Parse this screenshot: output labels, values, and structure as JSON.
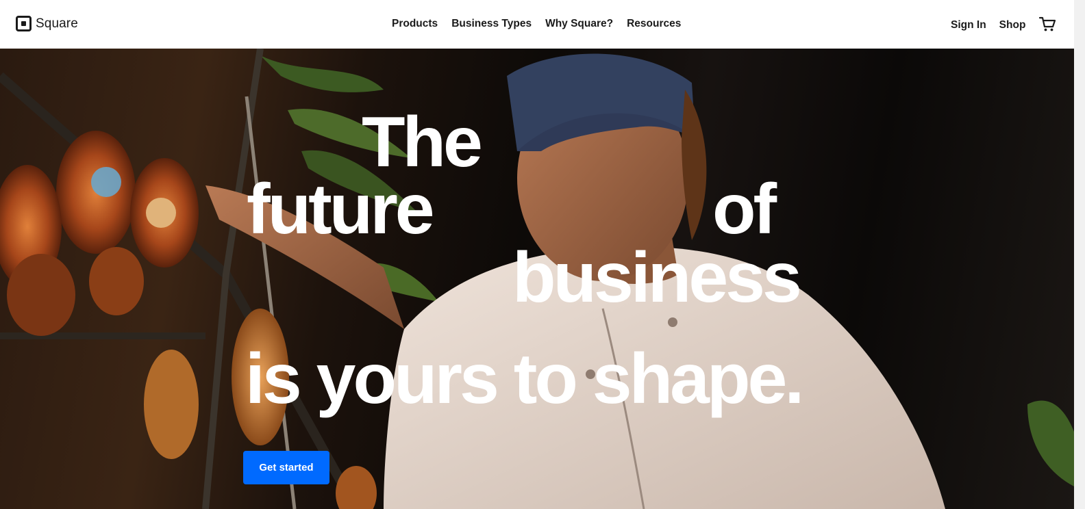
{
  "header": {
    "logo_text": "Square",
    "nav": [
      {
        "label": "Products"
      },
      {
        "label": "Business Types"
      },
      {
        "label": "Why Square?"
      },
      {
        "label": "Resources"
      }
    ],
    "sign_in_label": "Sign In",
    "shop_label": "Shop",
    "cart_icon": "shopping-cart-icon"
  },
  "hero": {
    "headline": {
      "line1": "The",
      "line2a": "future",
      "line2b": "of",
      "line3": "business",
      "line4": "is yours to shape."
    },
    "cta_label": "Get started",
    "cta_color": "#006aff",
    "headline_color": "#ffffff"
  }
}
